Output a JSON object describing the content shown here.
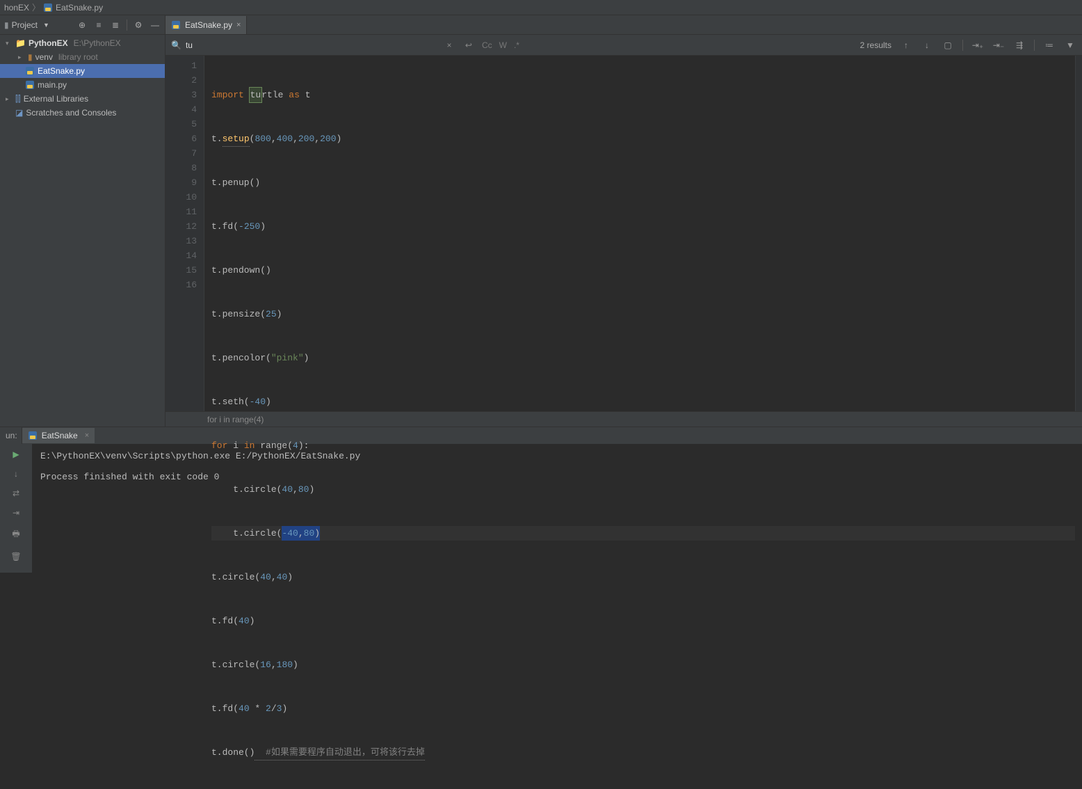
{
  "breadcrumb": {
    "project": "honEX",
    "file": "EatSnake.py"
  },
  "project_panel": {
    "title": "Project",
    "root_name": "PythonEX",
    "root_path": "E:\\PythonEX",
    "venv": "venv",
    "venv_note": "library root",
    "file1": "EatSnake.py",
    "file2": "main.py",
    "ext_lib": "External Libraries",
    "scratches": "Scratches and Consoles"
  },
  "tabs": {
    "active": "EatSnake.py"
  },
  "find": {
    "query": "tu",
    "cc": "Cc",
    "w": "W",
    "results": "2 results"
  },
  "code": {
    "lines": [
      "1",
      "2",
      "3",
      "4",
      "5",
      "6",
      "7",
      "8",
      "9",
      "10",
      "11",
      "12",
      "13",
      "14",
      "15",
      "16"
    ],
    "l1_import": "import",
    "l1_tu": "tu",
    "l1_rtle": "rtle",
    "l1_as": "as",
    "l1_t": "t",
    "l2_t": "t.",
    "l2_setup": "setup",
    "l2_open": "(",
    "l2_800": "800",
    "l2_c1": ",",
    "l2_400": "400",
    "l2_c2": ",",
    "l2_200a": "200",
    "l2_c3": ",",
    "l2_200b": "200",
    "l2_close": ")",
    "l3": "t.penup()",
    "l4_a": "t.fd(",
    "l4_n": "-250",
    "l4_b": ")",
    "l5": "t.pendown()",
    "l6_a": "t.pensize(",
    "l6_n": "25",
    "l6_b": ")",
    "l7_a": "t.pencolor(",
    "l7_s": "\"pink\"",
    "l7_b": ")",
    "l8_a": "t.seth(",
    "l8_n": "-40",
    "l8_b": ")",
    "l9_for": "for",
    "l9_i": " i ",
    "l9_in": "in",
    "l9_range": " range(",
    "l9_n": "4",
    "l9_b": "):",
    "l10_a": "    t.circle(",
    "l10_n1": "40",
    "l10_c": ",",
    "l10_n2": "80",
    "l10_b": ")",
    "l11_a": "    t.circle(",
    "l11_n1": "-40",
    "l11_c": ",",
    "l11_n2": "80",
    "l11_b": ")",
    "l12_a": "t.circle(",
    "l12_n1": "40",
    "l12_c": ",",
    "l12_n2": "40",
    "l12_b": ")",
    "l13_a": "t.fd(",
    "l13_n": "40",
    "l13_b": ")",
    "l14_a": "t.circle(",
    "l14_n1": "16",
    "l14_c": ",",
    "l14_n2": "180",
    "l14_b": ")",
    "l15_a": "t.fd(",
    "l15_n1": "40",
    "l15_op": " * ",
    "l15_n2": "2",
    "l15_sl": "/",
    "l15_n3": "3",
    "l15_b": ")",
    "l16_a": "t.done()",
    "l16_cmt": "  #如果需要程序自动退出，可将该行去掉",
    "status": "for i in range(4)"
  },
  "run": {
    "label": "un:",
    "tab": "EatSnake",
    "line1": "E:\\PythonEX\\venv\\Scripts\\python.exe E:/PythonEX/EatSnake.py",
    "line2": "Process finished with exit code 0"
  }
}
